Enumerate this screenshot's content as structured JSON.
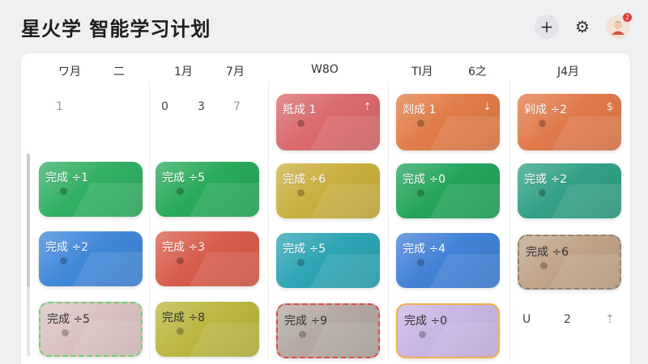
{
  "app": {
    "title": "星火学 智能学习计划"
  },
  "toolbar": {
    "add_icon": "plus-icon",
    "settings_icon": "gear-icon",
    "avatar_badge": "2"
  },
  "grid": {
    "headers": [
      "ワ月",
      "二",
      "1月",
      "7月",
      "W8O",
      "TI月",
      "6之",
      "J4月"
    ],
    "day_numbers": [
      "1",
      "0",
      "3",
      "7"
    ],
    "bottom_cell": [
      "U",
      "2",
      "⇡"
    ]
  },
  "cards": [
    {
      "label": "羝成 1",
      "color": "#d9676b",
      "corner": "⇡"
    },
    {
      "label": "剡成 1",
      "color": "#e07a45",
      "corner": "⇣"
    },
    {
      "label": "剁成 ÷2",
      "color": "#e0784a",
      "corner": "$"
    },
    {
      "label": "完成 ÷1",
      "color": "#2fae63"
    },
    {
      "label": "完成 ÷5",
      "color": "#26a85a"
    },
    {
      "label": "完成 ÷6",
      "color": "#c9ad3c"
    },
    {
      "label": "完成 ÷0",
      "color": "#22a35a"
    },
    {
      "label": "完或 ÷2",
      "color": "#2f9f86"
    },
    {
      "label": "完成 ÷2",
      "color": "#3e86d9"
    },
    {
      "label": "完成 ÷3",
      "color": "#d75a48"
    },
    {
      "label": "完成 ÷5",
      "color": "#2aa3b3"
    },
    {
      "label": "完成 ÷4",
      "color": "#3f7fd6"
    },
    {
      "label": "完成 ÷6",
      "color": "#bfa287"
    },
    {
      "label": "完成 ÷5",
      "color": "#d8c2c0"
    },
    {
      "label": "完成 ÷8",
      "color": "#b9b63e"
    },
    {
      "label": "完成 ÷9",
      "color": "#b3a7a0"
    },
    {
      "label": "完成 ÷0",
      "color": "#c7b4e3"
    }
  ]
}
